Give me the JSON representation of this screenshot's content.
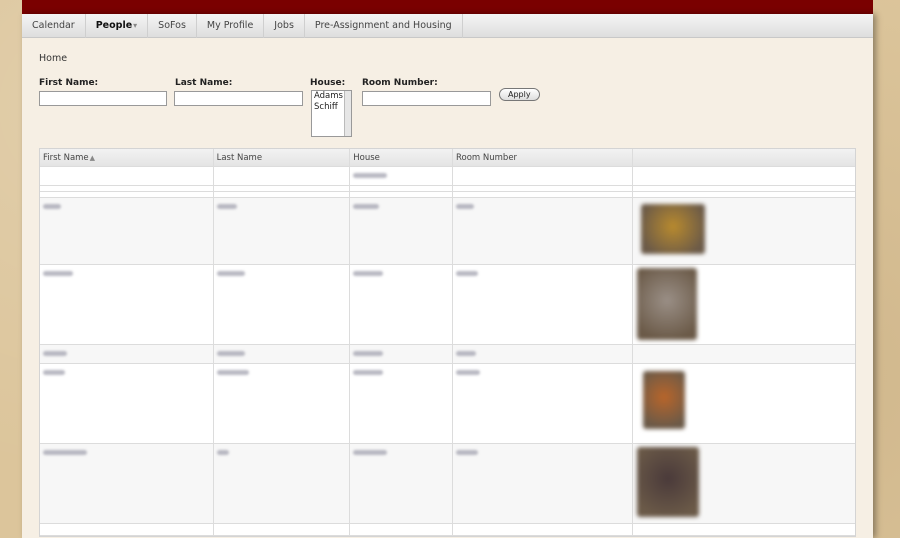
{
  "nav": {
    "items": [
      {
        "label": "Calendar",
        "active": false
      },
      {
        "label": "People",
        "active": true
      },
      {
        "label": "SoFos",
        "active": false
      },
      {
        "label": "My Profile",
        "active": false
      },
      {
        "label": "Jobs",
        "active": false
      },
      {
        "label": "Pre-Assignment and Housing",
        "active": false
      }
    ],
    "people_caret": "▾"
  },
  "breadcrumb": "Home",
  "filters": {
    "first_name_label": "First Name:",
    "first_name_value": "",
    "last_name_label": "Last Name:",
    "last_name_value": "",
    "house_label": "House:",
    "house_options": [
      "Adams",
      "Schiff"
    ],
    "room_label": "Room Number:",
    "room_value": "",
    "apply_label": "Apply"
  },
  "table": {
    "headers": [
      "First Name",
      "Last Name",
      "House",
      "Room Number",
      ""
    ],
    "sort_indicator": "▲",
    "photo_colors": [
      "#b88a2e",
      "#9a8f86",
      "#b8652a",
      "#4a3a3a"
    ]
  }
}
